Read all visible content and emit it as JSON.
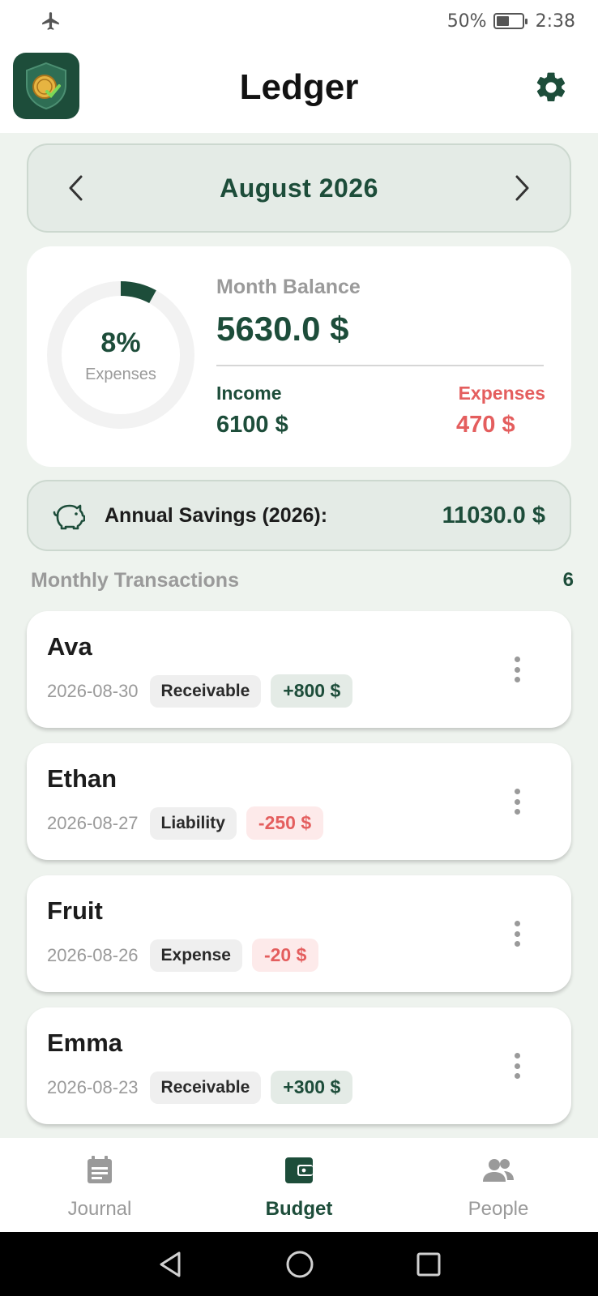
{
  "status": {
    "battery": "50%",
    "time": "2:38"
  },
  "header": {
    "title": "Ledger"
  },
  "month_nav": {
    "label": "August 2026"
  },
  "summary": {
    "expense_pct_text": "8%",
    "expense_pct_value": 0.08,
    "ring_label": "Expenses",
    "balance_label": "Month Balance",
    "balance_value": "5630.0 $",
    "income_label": "Income",
    "income_value": "6100 $",
    "expenses_label": "Expenses",
    "expenses_value": "470 $"
  },
  "savings": {
    "label": "Annual Savings (2026):",
    "value": "11030.0 $"
  },
  "transactions": {
    "header": "Monthly Transactions",
    "count": "6",
    "items": [
      {
        "name": "Ava",
        "date": "2026-08-30",
        "type": "Receivable",
        "amount": "+800 $"
      },
      {
        "name": "Ethan",
        "date": "2026-08-27",
        "type": "Liability",
        "amount": "-250 $"
      },
      {
        "name": "Fruit",
        "date": "2026-08-26",
        "type": "Expense",
        "amount": "-20 $"
      },
      {
        "name": "Emma",
        "date": "2026-08-23",
        "type": "Receivable",
        "amount": "+300 $"
      }
    ]
  },
  "bottom_nav": {
    "items": [
      {
        "label": "Journal",
        "icon": "journal-icon"
      },
      {
        "label": "Budget",
        "icon": "wallet-icon"
      },
      {
        "label": "People",
        "icon": "people-icon"
      }
    ],
    "active": "Budget"
  },
  "colors": {
    "brand": "#1d4d3a",
    "expense": "#e45e5e",
    "background": "#eef3ee",
    "muted": "#9a9a9a"
  }
}
